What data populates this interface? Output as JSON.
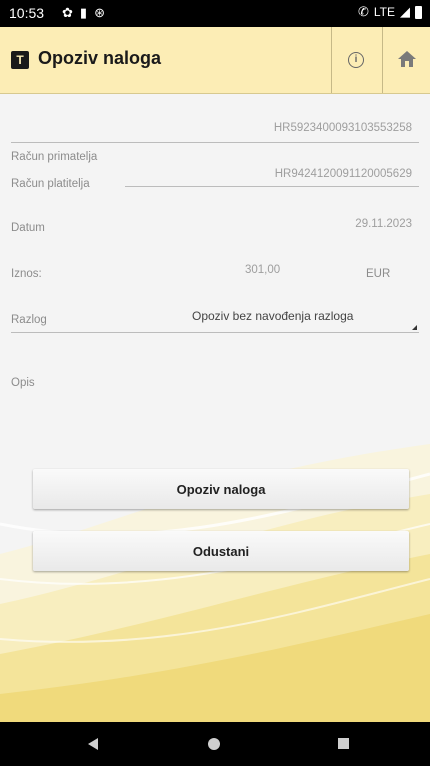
{
  "status_bar": {
    "time": "10:53",
    "network": "LTE",
    "icons_left": [
      "settings-gear-icon",
      "sd-card-icon",
      "sync-icon"
    ],
    "icons_right": [
      "wifi-calling-icon",
      "signal-icon",
      "battery-icon"
    ]
  },
  "app_bar": {
    "title": "Opoziv naloga",
    "background": "#fcedb5",
    "icons": [
      "info-icon",
      "home-icon"
    ]
  },
  "form": {
    "recipient_account": {
      "label": "Račun primatelja",
      "value": "HR5923400093103553258"
    },
    "payer_account": {
      "label": "Račun platitelja",
      "value": "HR9424120091120005629"
    },
    "date": {
      "label": "Datum",
      "value": "29.11.2023"
    },
    "amount": {
      "label": "Iznos:",
      "value": "301,00",
      "currency": "EUR"
    },
    "reason": {
      "label": "Razlog",
      "selected": "Opoziv bez navođenja razloga"
    },
    "description": {
      "label": "Opis",
      "value": ""
    }
  },
  "buttons": {
    "revoke": "Opoziv naloga",
    "cancel": "Odustani"
  },
  "nav_bar": {
    "icons": [
      "back-icon",
      "home-circle-icon",
      "recent-apps-icon"
    ]
  }
}
